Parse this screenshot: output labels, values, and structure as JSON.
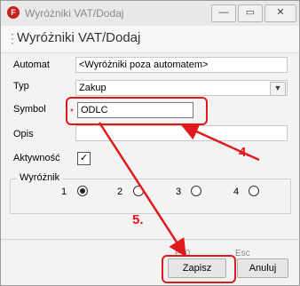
{
  "window": {
    "title": "Wyróżniki VAT/Dodaj",
    "icon_letter": "F",
    "buttons": {
      "minimize": "—",
      "maximize": "▭",
      "close": "✕"
    }
  },
  "header": {
    "title": "Wyróżniki VAT/Dodaj"
  },
  "form": {
    "automat": {
      "label": "Automat",
      "value": "<Wyróżniki poza automatem>"
    },
    "typ": {
      "label": "Typ",
      "value": "Zakup",
      "dropdown_icon": "chevron-down-icon"
    },
    "symbol": {
      "label": "Symbol",
      "value": "ODLC",
      "required_mark": "*"
    },
    "opis": {
      "label": "Opis",
      "value": ""
    },
    "aktywnosc": {
      "label": "Aktywność",
      "checked": true,
      "check_glyph": "✓"
    }
  },
  "wyroznik": {
    "label": "Wyróżnik",
    "options": [
      "1",
      "2",
      "3",
      "4"
    ],
    "selected": "1"
  },
  "footer": {
    "save": {
      "label": "Zapisz",
      "shortcut": "F10"
    },
    "cancel": {
      "label": "Anuluj",
      "shortcut": "Esc"
    }
  },
  "annotations": {
    "step4": "4.",
    "step5": "5."
  },
  "colors": {
    "annotation": "#e0191d",
    "brand": "#c8201e"
  }
}
